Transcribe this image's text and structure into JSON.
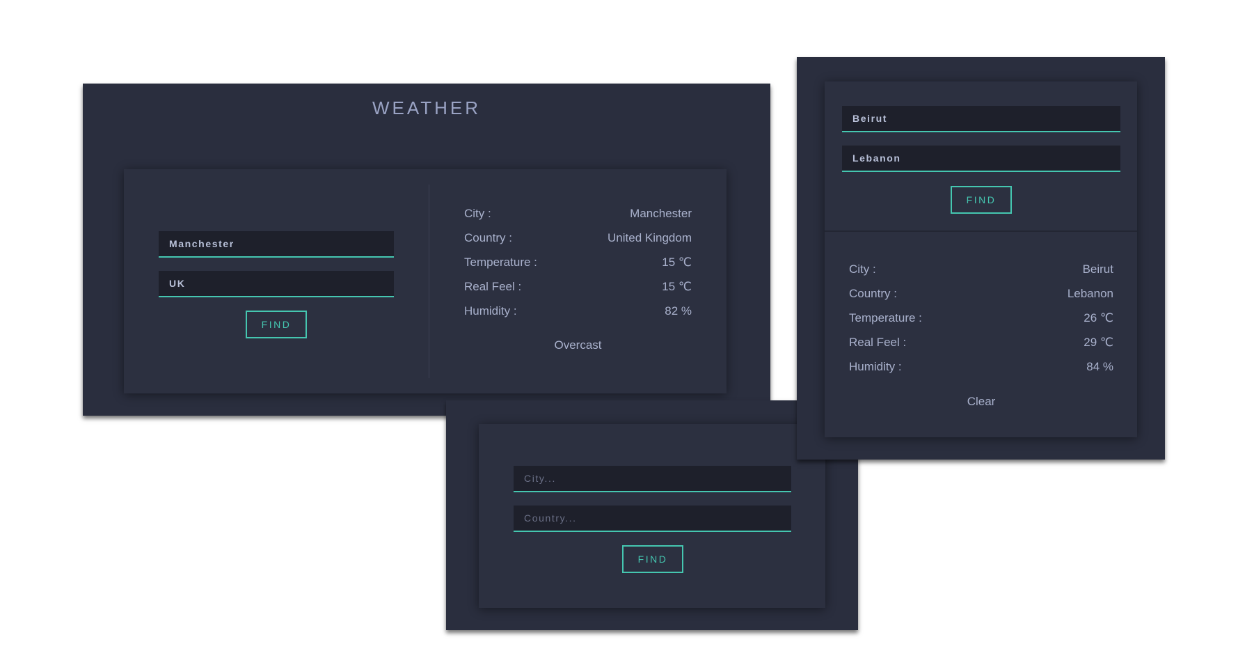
{
  "main": {
    "title": "WEATHER",
    "city_value": "Manchester",
    "country_value": "UK",
    "find_label": "FIND",
    "rows": [
      {
        "label": "City :",
        "value": "Manchester"
      },
      {
        "label": "Country :",
        "value": "United Kingdom"
      },
      {
        "label": "Temperature :",
        "value": "15 ℃"
      },
      {
        "label": "Real Feel :",
        "value": "15 ℃"
      },
      {
        "label": "Humidity :",
        "value": "82 %"
      }
    ],
    "description": "Overcast"
  },
  "empty_form": {
    "city_placeholder": "City...",
    "country_placeholder": "Country...",
    "find_label": "FIND"
  },
  "side": {
    "city_value": "Beirut",
    "country_value": "Lebanon",
    "find_label": "FIND",
    "rows": [
      {
        "label": "City :",
        "value": "Beirut"
      },
      {
        "label": "Country :",
        "value": "Lebanon"
      },
      {
        "label": "Temperature :",
        "value": "26 ℃"
      },
      {
        "label": "Real Feel :",
        "value": "29 ℃"
      },
      {
        "label": "Humidity :",
        "value": "84 %"
      }
    ],
    "description": "Clear"
  },
  "colors": {
    "background": "#ffffff",
    "panel": "#2a2e3e",
    "card": "#2c3040",
    "input": "#1e202b",
    "accent": "#45c6b0",
    "text": "#a9b1cc"
  }
}
